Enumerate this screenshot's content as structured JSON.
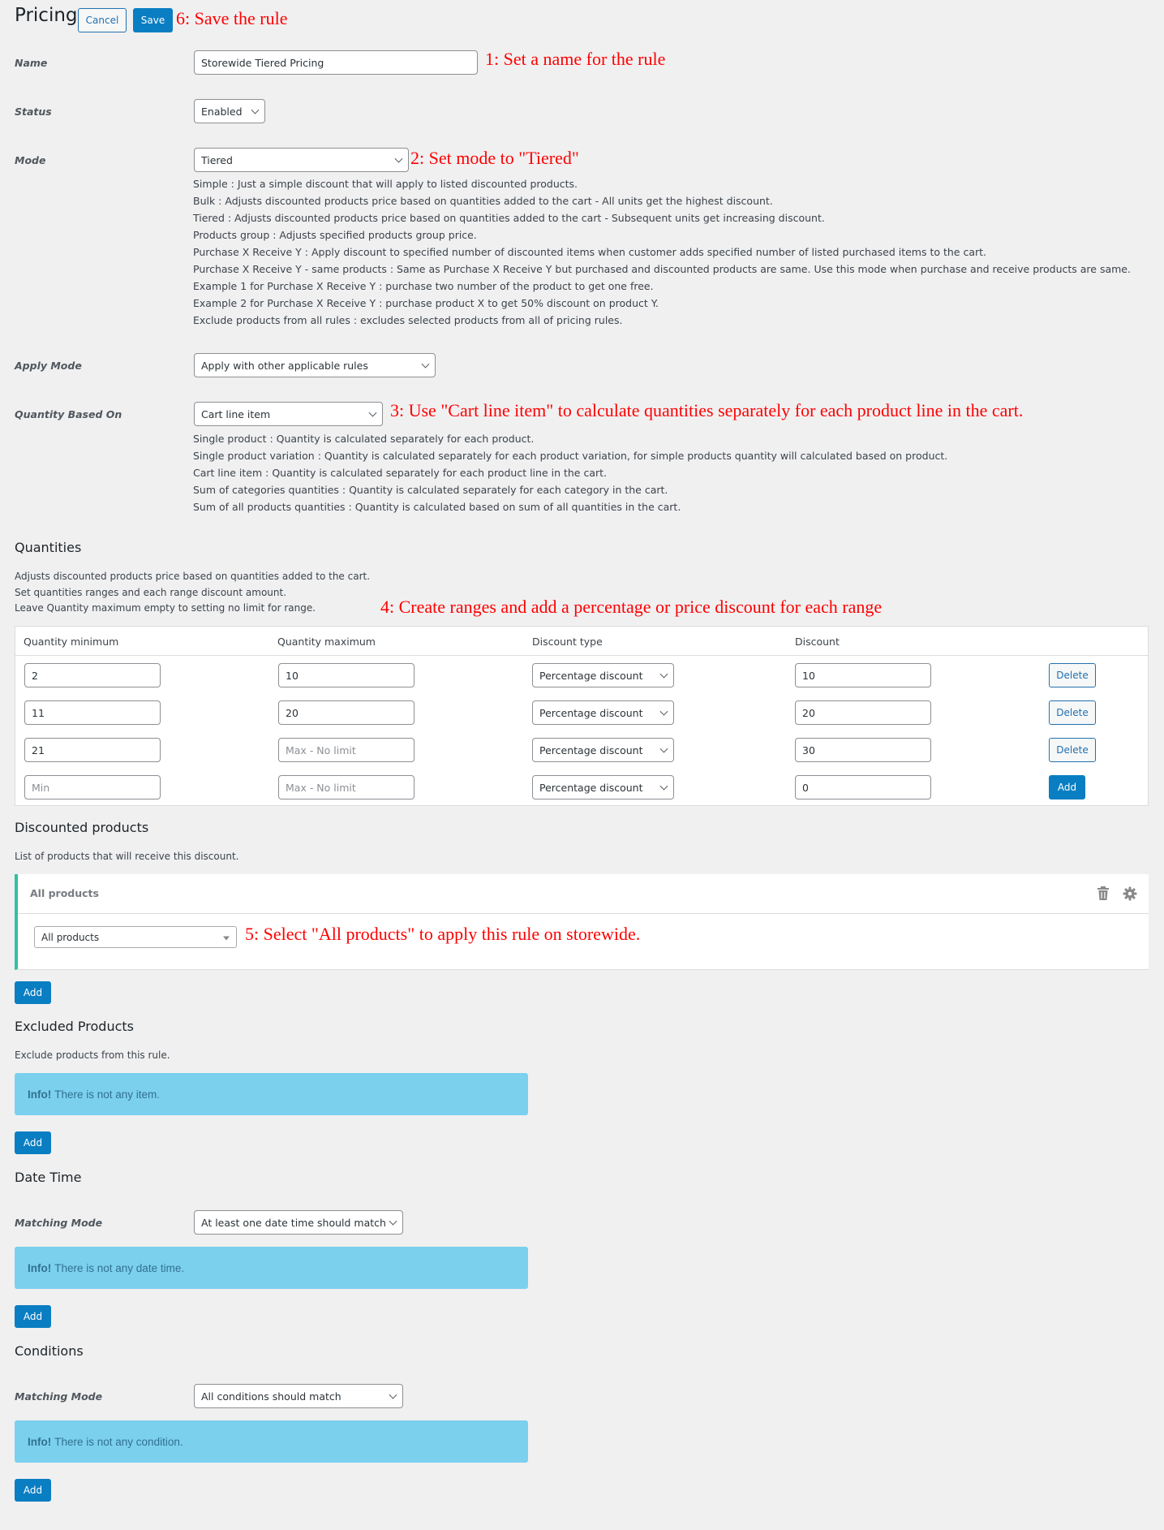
{
  "header": {
    "title": "Pricing",
    "cancel_label": "Cancel",
    "save_label": "Save"
  },
  "annotations": {
    "save": "6: Save the rule",
    "name": "1: Set a name for the rule",
    "mode": "2: Set mode to \"Tiered\"",
    "quantity_based_on": "3: Use \"Cart line item\" to calculate quantities separately for each product line in the cart.",
    "quantities": "4: Create ranges and add a percentage or price discount for each range",
    "discounted_products": "5: Select \"All products\" to apply this rule on storewide."
  },
  "fields": {
    "name": {
      "label": "Name",
      "value": "Storewide Tiered Pricing"
    },
    "status": {
      "label": "Status",
      "value": "Enabled"
    },
    "mode": {
      "label": "Mode",
      "value": "Tiered",
      "descriptions": [
        "Simple : Just a simple discount that will apply to listed discounted products.",
        "Bulk : Adjusts discounted products price based on quantities added to the cart - All units get the highest discount.",
        "Tiered : Adjusts discounted products price based on quantities added to the cart - Subsequent units get increasing discount.",
        "Products group : Adjusts specified products group price.",
        "Purchase X Receive Y : Apply discount to specified number of discounted items when customer adds specified number of listed purchased items to the cart.",
        "Purchase X Receive Y - same products : Same as Purchase X Receive Y but purchased and discounted products are same. Use this mode when purchase and receive products are same.",
        "Example 1 for Purchase X Receive Y : purchase two number of the product to get one free.",
        "Example 2 for Purchase X Receive Y : purchase product X to get 50% discount on product Y.",
        "Exclude products from all rules : excludes selected products from all of pricing rules."
      ]
    },
    "apply_mode": {
      "label": "Apply Mode",
      "value": "Apply with other applicable rules"
    },
    "quantity_based_on": {
      "label": "Quantity Based On",
      "value": "Cart line item",
      "descriptions": [
        "Single product : Quantity is calculated separately for each product.",
        "Single product variation : Quantity is calculated separately for each product variation, for simple products quantity will calculated based on product.",
        "Cart line item : Quantity is calculated separately for each product line in the cart.",
        "Sum of categories quantities : Quantity is calculated separately for each category in the cart.",
        "Sum of all products quantities : Quantity is calculated based on sum of all quantities in the cart."
      ]
    }
  },
  "quantities": {
    "title": "Quantities",
    "descriptions": [
      "Adjusts discounted products price based on quantities added to the cart.",
      "Set quantities ranges and each range discount amount.",
      "Leave Quantity maximum empty to setting no limit for range."
    ],
    "columns": [
      "Quantity minimum",
      "Quantity maximum",
      "Discount type",
      "Discount"
    ],
    "rows": [
      {
        "min": "2",
        "max": "10",
        "max_placeholder": "",
        "type": "Percentage discount",
        "discount": "10",
        "action": "Delete"
      },
      {
        "min": "11",
        "max": "20",
        "max_placeholder": "",
        "type": "Percentage discount",
        "discount": "20",
        "action": "Delete"
      },
      {
        "min": "21",
        "max": "",
        "max_placeholder": "Max - No limit",
        "type": "Percentage discount",
        "discount": "30",
        "action": "Delete"
      }
    ],
    "new_row": {
      "min_placeholder": "Min",
      "max_placeholder": "Max - No limit",
      "type": "Percentage discount",
      "discount": "0",
      "action": "Add"
    }
  },
  "discounted_products": {
    "title": "Discounted products",
    "description": "List of products that will receive this discount.",
    "item_title": "All products",
    "item_select": "All products",
    "add_label": "Add"
  },
  "excluded_products": {
    "title": "Excluded Products",
    "description": "Exclude products from this rule.",
    "info_strong": "Info!",
    "info_text": "There is not any item.",
    "add_label": "Add"
  },
  "date_time": {
    "title": "Date Time",
    "matching_label": "Matching Mode",
    "matching_value": "At least one date time should match",
    "info_strong": "Info!",
    "info_text": "There is not any date time.",
    "add_label": "Add"
  },
  "conditions": {
    "title": "Conditions",
    "matching_label": "Matching Mode",
    "matching_value": "All conditions should match",
    "info_strong": "Info!",
    "info_text": "There is not any condition.",
    "add_label": "Add"
  }
}
